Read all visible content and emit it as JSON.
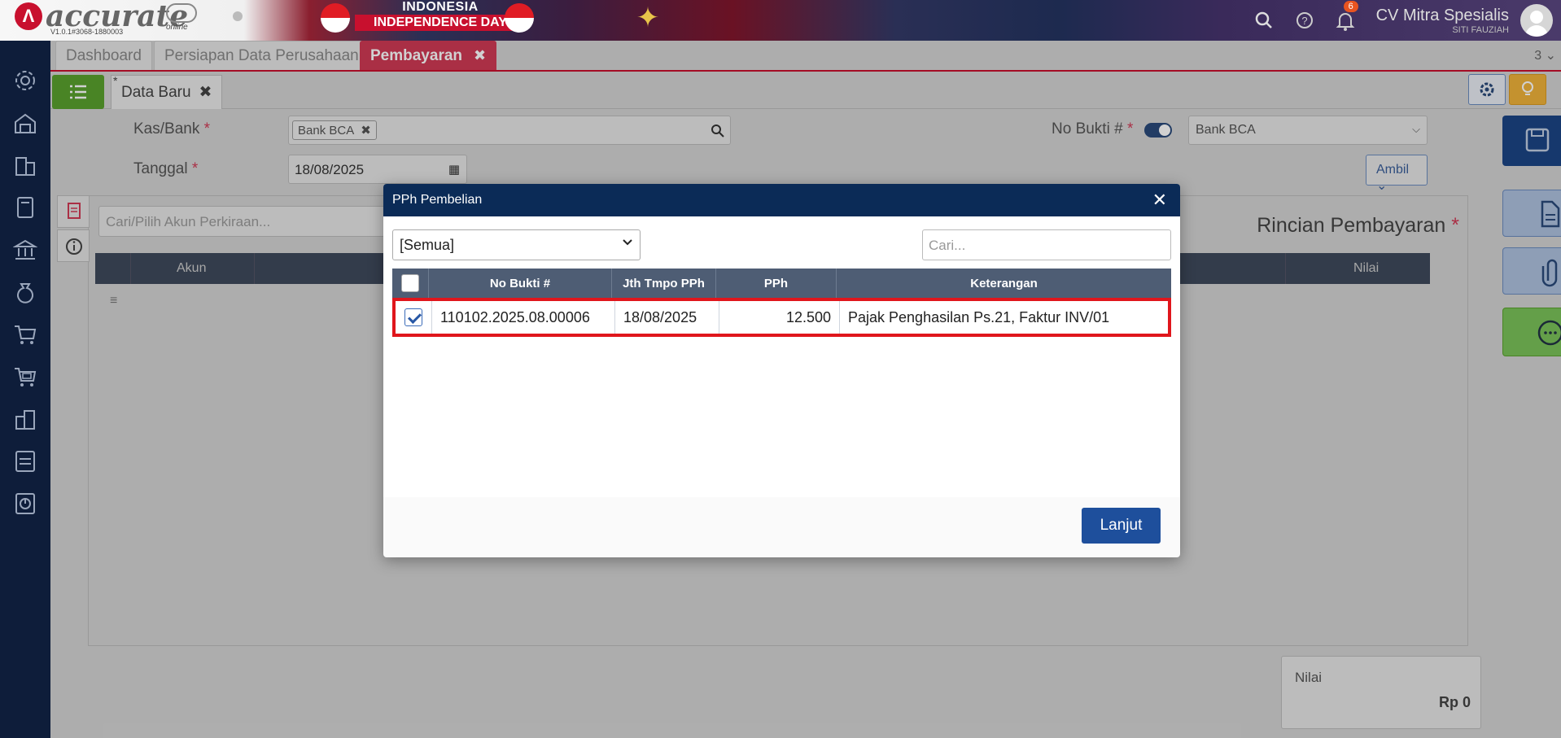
{
  "header": {
    "brand": "accurate",
    "brand_sub": "online",
    "version": "V1.0.1#3068-1880003",
    "banner_line1": "INDONESIA",
    "banner_line2": "INDEPENDENCE DAY",
    "notification_count": "6",
    "company_name": "CV Mitra Spesialis",
    "user_name": "SITI FAUZIAH"
  },
  "tabs": [
    {
      "label": "Dashboard"
    },
    {
      "label": "Persiapan Data Perusahaan"
    },
    {
      "label": "Pembayaran",
      "active": true
    }
  ],
  "tab_count": "3",
  "doc_tab": {
    "label": "Data Baru",
    "modified_marker": "*"
  },
  "form": {
    "kas_bank_label": "Kas/Bank",
    "kas_bank_value": "Bank BCA",
    "tanggal_label": "Tanggal",
    "tanggal_value": "18/08/2025",
    "no_bukti_label": "No Bukti #",
    "no_bukti_select": "Bank BCA",
    "ambil_label": "Ambil",
    "required_marker": "*"
  },
  "detail": {
    "search_placeholder": "Cari/Pilih Akun Perkiraan...",
    "title": "Rincian Pembayaran",
    "col_akun": "Akun",
    "col_nilai": "Nilai"
  },
  "summary": {
    "label": "Nilai",
    "value": "Rp 0"
  },
  "modal": {
    "title": "PPh Pembelian",
    "filter_value": "[Semua]",
    "search_placeholder": "Cari...",
    "columns": [
      "No Bukti #",
      "Jth Tmpo PPh",
      "PPh",
      "Keterangan"
    ],
    "rows": [
      {
        "checked": true,
        "no_bukti": "110102.2025.08.00006",
        "jth_tempo": "18/08/2025",
        "pph": "12.500",
        "keterangan": "Pajak Penghasilan Ps.21, Faktur INV/01"
      }
    ],
    "continue_label": "Lanjut"
  },
  "colors": {
    "sidebar": "#0e1d3a",
    "active_tab": "#d03a55",
    "modal_header": "#0b2b57",
    "table_header": "#4e5d74",
    "highlight": "#e0161c",
    "primary_button": "#1e4f9c"
  }
}
